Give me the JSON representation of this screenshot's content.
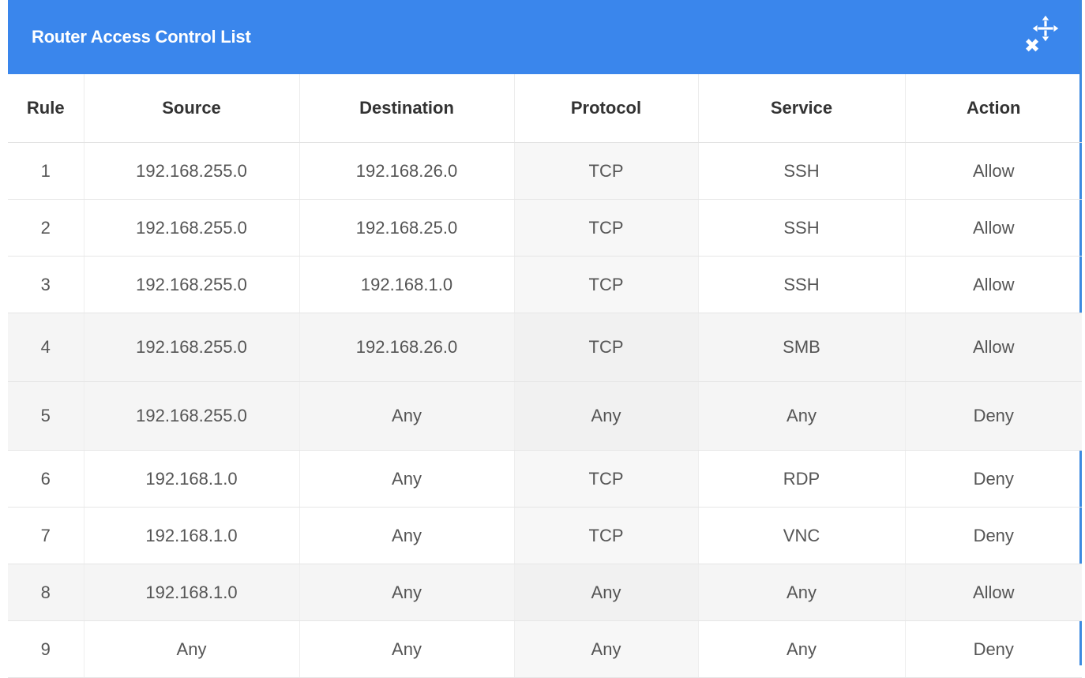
{
  "window": {
    "title": "Router Access Control List",
    "icons": [
      "close-icon",
      "move-icon"
    ]
  },
  "table": {
    "headers": [
      "Rule",
      "Source",
      "Destination",
      "Protocol",
      "Service",
      "Action"
    ],
    "rows": [
      [
        "1",
        "192.168.255.0",
        "192.168.26.0",
        "TCP",
        "SSH",
        "Allow"
      ],
      [
        "2",
        "192.168.255.0",
        "192.168.25.0",
        "TCP",
        "SSH",
        "Allow"
      ],
      [
        "3",
        "192.168.255.0",
        "192.168.1.0",
        "TCP",
        "SSH",
        "Allow"
      ],
      [
        "4",
        "192.168.255.0",
        "192.168.26.0",
        "TCP",
        "SMB",
        "Allow"
      ],
      [
        "5",
        "192.168.255.0",
        "Any",
        "Any",
        "Any",
        "Deny"
      ],
      [
        "6",
        "192.168.1.0",
        "Any",
        "TCP",
        "RDP",
        "Deny"
      ],
      [
        "7",
        "192.168.1.0",
        "Any",
        "TCP",
        "VNC",
        "Deny"
      ],
      [
        "8",
        "192.168.1.0",
        "Any",
        "Any",
        "Any",
        "Allow"
      ],
      [
        "9",
        "Any",
        "Any",
        "Any",
        "Any",
        "Deny"
      ]
    ]
  },
  "colors": {
    "titlebar": "#3a86ec",
    "title_text": "#ffffff",
    "header_text": "#333333",
    "cell_text": "#555555"
  }
}
